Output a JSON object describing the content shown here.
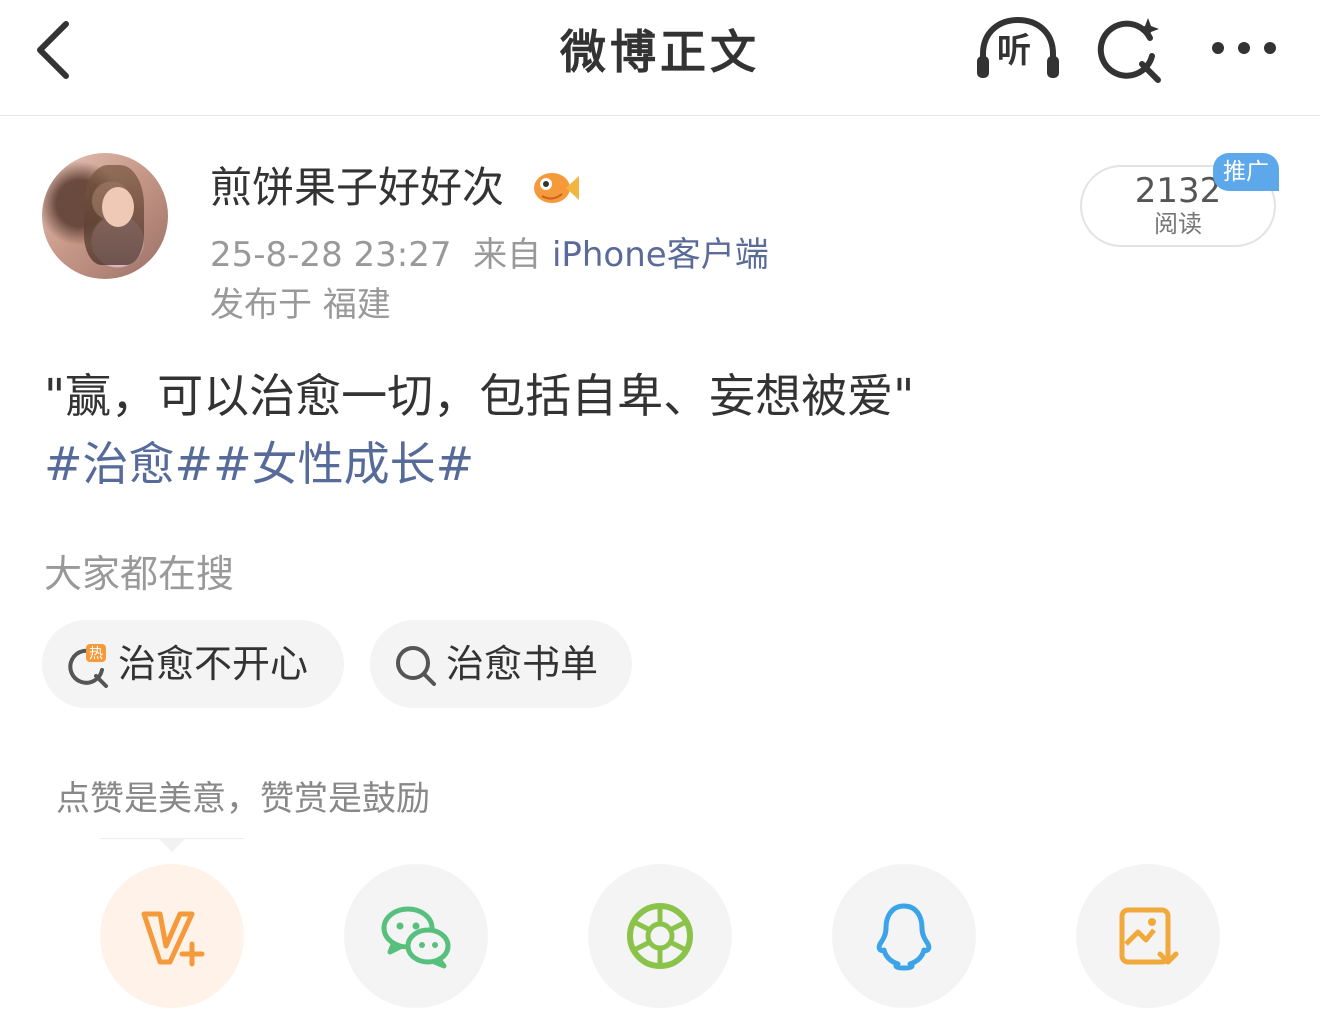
{
  "header": {
    "title": "微博正文",
    "listen_label": "听"
  },
  "post": {
    "author": "煎饼果子好好次",
    "time": "25-8-28 23:27",
    "source_prefix": "来自",
    "source": "iPhone客户端",
    "location": "发布于 福建",
    "reads_count": "2132",
    "reads_label": "阅读",
    "promo_badge": "推广",
    "text": "\"赢，可以治愈一切，包括自卑、妄想被爱\"",
    "tags": [
      "#治愈#",
      "#女性成长#"
    ]
  },
  "search": {
    "title": "大家都在搜",
    "chips": [
      {
        "label": "治愈不开心",
        "icon": "hot-search-icon"
      },
      {
        "label": "治愈书单",
        "icon": "search-icon"
      }
    ]
  },
  "reward_hint": "点赞是美意，赞赏是鼓励",
  "share_items": [
    {
      "icon": "reward-icon"
    },
    {
      "icon": "wechat-icon"
    },
    {
      "icon": "moments-icon"
    },
    {
      "icon": "qq-icon"
    },
    {
      "icon": "save-image-icon"
    }
  ],
  "colors": {
    "accent_orange": "#f59a3a",
    "link_blue": "#566b9a",
    "wechat_green": "#57c07d",
    "moments_green": "#8bc34a",
    "qq_blue": "#3ba3e8",
    "promo_blue": "#5ca8ea"
  }
}
